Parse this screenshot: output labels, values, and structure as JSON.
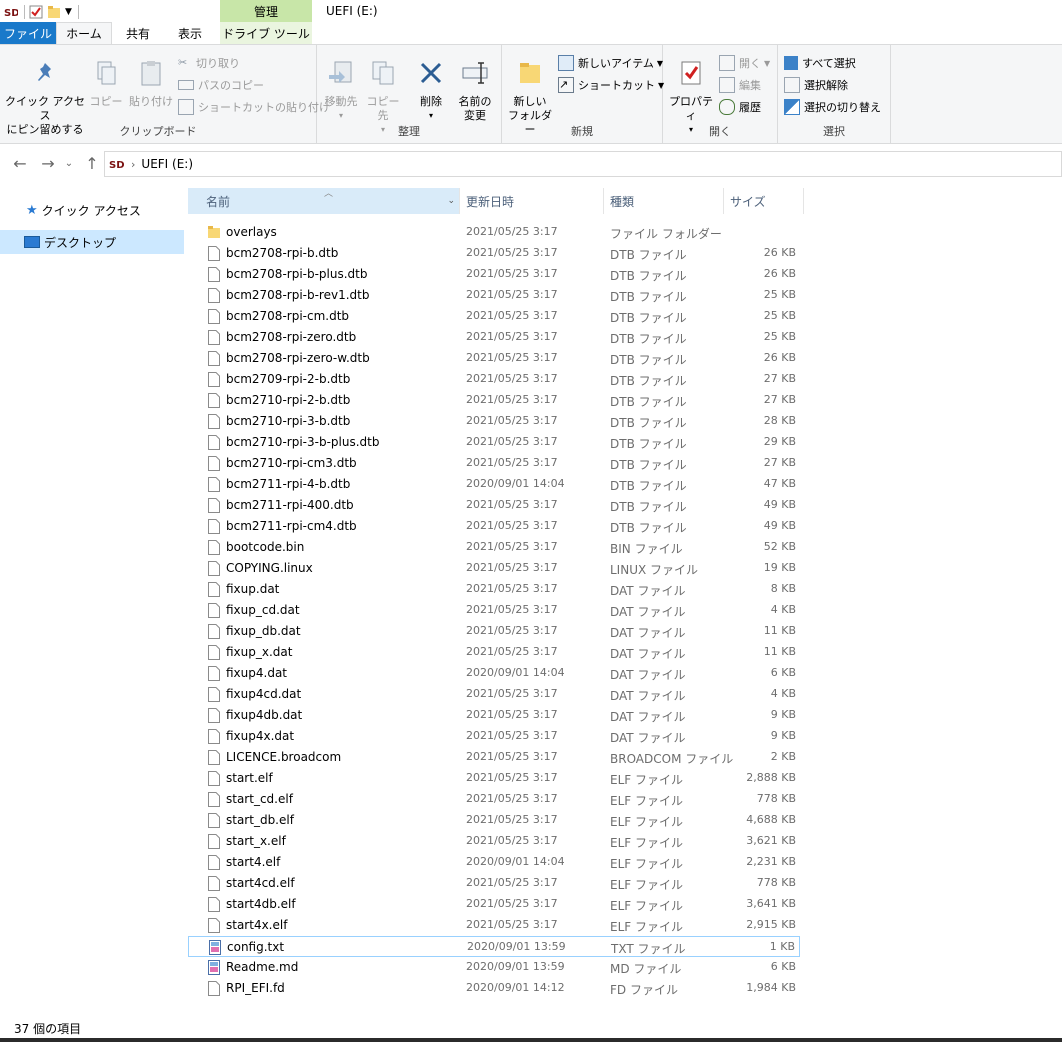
{
  "window": {
    "title": "UEFI (E:)"
  },
  "ribbon_tabs": {
    "file": "ファイル",
    "home": "ホーム",
    "share": "共有",
    "view": "表示",
    "context_group": "管理",
    "drive_tools": "ドライブ ツール"
  },
  "clipboard": {
    "label": "クリップボード",
    "pin_line1": "クイック アクセス",
    "pin_line2": "にピン留めする",
    "copy": "コピー",
    "paste": "貼り付け",
    "cut": "切り取り",
    "copy_path": "パスのコピー",
    "paste_shortcut": "ショートカットの貼り付け"
  },
  "organize": {
    "label": "整理",
    "move_to": "移動先",
    "copy_to": "コピー先",
    "delete": "削除",
    "rename_line1": "名前の",
    "rename_line2": "変更"
  },
  "new": {
    "label": "新規",
    "new_folder_line1": "新しい",
    "new_folder_line2": "フォルダー",
    "new_item": "新しいアイテム",
    "shortcut": "ショートカット"
  },
  "open": {
    "label": "開く",
    "properties": "プロパティ",
    "open": "開く",
    "edit": "編集",
    "history": "履歴"
  },
  "select": {
    "label": "選択",
    "select_all": "すべて選択",
    "select_none": "選択解除",
    "invert": "選択の切り替え"
  },
  "address": {
    "path": "UEFI (E:)"
  },
  "nav_pane": {
    "quick_access": "クイック アクセス",
    "desktop": "デスクトップ"
  },
  "columns": {
    "name": "名前",
    "date": "更新日時",
    "type": "種類",
    "size": "サイズ"
  },
  "files": [
    {
      "name": "overlays",
      "date": "2021/05/25 3:17",
      "type": "ファイル フォルダー",
      "size": "",
      "kind": "folder"
    },
    {
      "name": "bcm2708-rpi-b.dtb",
      "date": "2021/05/25 3:17",
      "type": "DTB ファイル",
      "size": "26 KB",
      "kind": "file"
    },
    {
      "name": "bcm2708-rpi-b-plus.dtb",
      "date": "2021/05/25 3:17",
      "type": "DTB ファイル",
      "size": "26 KB",
      "kind": "file"
    },
    {
      "name": "bcm2708-rpi-b-rev1.dtb",
      "date": "2021/05/25 3:17",
      "type": "DTB ファイル",
      "size": "25 KB",
      "kind": "file"
    },
    {
      "name": "bcm2708-rpi-cm.dtb",
      "date": "2021/05/25 3:17",
      "type": "DTB ファイル",
      "size": "25 KB",
      "kind": "file"
    },
    {
      "name": "bcm2708-rpi-zero.dtb",
      "date": "2021/05/25 3:17",
      "type": "DTB ファイル",
      "size": "25 KB",
      "kind": "file"
    },
    {
      "name": "bcm2708-rpi-zero-w.dtb",
      "date": "2021/05/25 3:17",
      "type": "DTB ファイル",
      "size": "26 KB",
      "kind": "file"
    },
    {
      "name": "bcm2709-rpi-2-b.dtb",
      "date": "2021/05/25 3:17",
      "type": "DTB ファイル",
      "size": "27 KB",
      "kind": "file"
    },
    {
      "name": "bcm2710-rpi-2-b.dtb",
      "date": "2021/05/25 3:17",
      "type": "DTB ファイル",
      "size": "27 KB",
      "kind": "file"
    },
    {
      "name": "bcm2710-rpi-3-b.dtb",
      "date": "2021/05/25 3:17",
      "type": "DTB ファイル",
      "size": "28 KB",
      "kind": "file"
    },
    {
      "name": "bcm2710-rpi-3-b-plus.dtb",
      "date": "2021/05/25 3:17",
      "type": "DTB ファイル",
      "size": "29 KB",
      "kind": "file"
    },
    {
      "name": "bcm2710-rpi-cm3.dtb",
      "date": "2021/05/25 3:17",
      "type": "DTB ファイル",
      "size": "27 KB",
      "kind": "file"
    },
    {
      "name": "bcm2711-rpi-4-b.dtb",
      "date": "2020/09/01 14:04",
      "type": "DTB ファイル",
      "size": "47 KB",
      "kind": "file"
    },
    {
      "name": "bcm2711-rpi-400.dtb",
      "date": "2021/05/25 3:17",
      "type": "DTB ファイル",
      "size": "49 KB",
      "kind": "file"
    },
    {
      "name": "bcm2711-rpi-cm4.dtb",
      "date": "2021/05/25 3:17",
      "type": "DTB ファイル",
      "size": "49 KB",
      "kind": "file"
    },
    {
      "name": "bootcode.bin",
      "date": "2021/05/25 3:17",
      "type": "BIN ファイル",
      "size": "52 KB",
      "kind": "file"
    },
    {
      "name": "COPYING.linux",
      "date": "2021/05/25 3:17",
      "type": "LINUX ファイル",
      "size": "19 KB",
      "kind": "file"
    },
    {
      "name": "fixup.dat",
      "date": "2021/05/25 3:17",
      "type": "DAT ファイル",
      "size": "8 KB",
      "kind": "file"
    },
    {
      "name": "fixup_cd.dat",
      "date": "2021/05/25 3:17",
      "type": "DAT ファイル",
      "size": "4 KB",
      "kind": "file"
    },
    {
      "name": "fixup_db.dat",
      "date": "2021/05/25 3:17",
      "type": "DAT ファイル",
      "size": "11 KB",
      "kind": "file"
    },
    {
      "name": "fixup_x.dat",
      "date": "2021/05/25 3:17",
      "type": "DAT ファイル",
      "size": "11 KB",
      "kind": "file"
    },
    {
      "name": "fixup4.dat",
      "date": "2020/09/01 14:04",
      "type": "DAT ファイル",
      "size": "6 KB",
      "kind": "file"
    },
    {
      "name": "fixup4cd.dat",
      "date": "2021/05/25 3:17",
      "type": "DAT ファイル",
      "size": "4 KB",
      "kind": "file"
    },
    {
      "name": "fixup4db.dat",
      "date": "2021/05/25 3:17",
      "type": "DAT ファイル",
      "size": "9 KB",
      "kind": "file"
    },
    {
      "name": "fixup4x.dat",
      "date": "2021/05/25 3:17",
      "type": "DAT ファイル",
      "size": "9 KB",
      "kind": "file"
    },
    {
      "name": "LICENCE.broadcom",
      "date": "2021/05/25 3:17",
      "type": "BROADCOM ファイル",
      "size": "2 KB",
      "kind": "file"
    },
    {
      "name": "start.elf",
      "date": "2021/05/25 3:17",
      "type": "ELF ファイル",
      "size": "2,888 KB",
      "kind": "file"
    },
    {
      "name": "start_cd.elf",
      "date": "2021/05/25 3:17",
      "type": "ELF ファイル",
      "size": "778 KB",
      "kind": "file"
    },
    {
      "name": "start_db.elf",
      "date": "2021/05/25 3:17",
      "type": "ELF ファイル",
      "size": "4,688 KB",
      "kind": "file"
    },
    {
      "name": "start_x.elf",
      "date": "2021/05/25 3:17",
      "type": "ELF ファイル",
      "size": "3,621 KB",
      "kind": "file"
    },
    {
      "name": "start4.elf",
      "date": "2020/09/01 14:04",
      "type": "ELF ファイル",
      "size": "2,231 KB",
      "kind": "file"
    },
    {
      "name": "start4cd.elf",
      "date": "2021/05/25 3:17",
      "type": "ELF ファイル",
      "size": "778 KB",
      "kind": "file"
    },
    {
      "name": "start4db.elf",
      "date": "2021/05/25 3:17",
      "type": "ELF ファイル",
      "size": "3,641 KB",
      "kind": "file"
    },
    {
      "name": "start4x.elf",
      "date": "2021/05/25 3:17",
      "type": "ELF ファイル",
      "size": "2,915 KB",
      "kind": "file"
    },
    {
      "name": "config.txt",
      "date": "2020/09/01 13:59",
      "type": "TXT ファイル",
      "size": "1 KB",
      "kind": "text",
      "selected": true
    },
    {
      "name": "Readme.md",
      "date": "2020/09/01 13:59",
      "type": "MD ファイル",
      "size": "6 KB",
      "kind": "text"
    },
    {
      "name": "RPI_EFI.fd",
      "date": "2020/09/01 14:12",
      "type": "FD ファイル",
      "size": "1,984 KB",
      "kind": "file"
    }
  ],
  "status": {
    "item_count": "37 個の項目"
  },
  "colors": {
    "file_tab": "#1979ca",
    "manage_tab": "#c8e6a8",
    "header_sel": "#d9ebf9",
    "row_sel_border": "#99d1ff",
    "folder": "#f8d775"
  },
  "icons": {
    "drive": "sd-card-icon",
    "folder": "folder-icon",
    "file": "file-icon",
    "text": "text-file-icon"
  }
}
